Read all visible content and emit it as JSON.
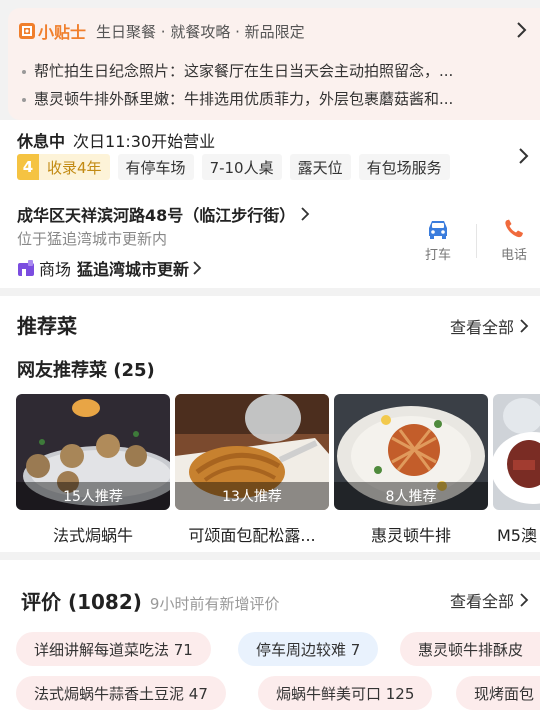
{
  "tips": {
    "logo_text": "小贴士",
    "tags": "生日聚餐 · 就餐攻略 · 新品限定",
    "items": [
      "帮忙拍生日纪念照片：这家餐厅在生日当天会主动拍照留念，...",
      "惠灵顿牛排外酥里嫩：牛排选用优质菲力，外层包裹蘑菇酱和..."
    ]
  },
  "info": {
    "status": "休息中",
    "open_time": "次日11:30开始营业",
    "years_badge_num": "4",
    "years_badge_text": "收录4年",
    "chips": [
      "有停车场",
      "7-10人桌",
      "露天位",
      "有包场服务"
    ],
    "address": "成华区天祥滨河路48号（临江步行街）",
    "address_sub": "位于猛追湾城市更新内",
    "mall_label": "商场",
    "mall_name": "猛追湾城市更新",
    "actions": [
      {
        "label": "打车",
        "icon": "car-icon",
        "color": "#3b7ddd"
      },
      {
        "label": "电话",
        "icon": "phone-icon",
        "color": "#f06a3c"
      }
    ]
  },
  "dishes": {
    "title": "推荐菜",
    "see_all": "查看全部",
    "subtitle": "网友推荐菜 (25)",
    "items": [
      {
        "name": "法式焗蜗牛",
        "rec": "15人推荐"
      },
      {
        "name": "可颂面包配松露...",
        "rec": "13人推荐"
      },
      {
        "name": "惠灵顿牛排",
        "rec": "8人推荐"
      },
      {
        "name": "M5澳",
        "rec": ""
      }
    ]
  },
  "reviews": {
    "title": "评价 (1082)",
    "subtitle": "9小时前有新增评价",
    "see_all": "查看全部",
    "tags_row1": [
      {
        "text": "详细讲解每道菜吃法 71",
        "style": "pink"
      },
      {
        "text": "停车周边较难 7",
        "style": "blue"
      },
      {
        "text": "惠灵顿牛排酥皮",
        "style": "pink"
      }
    ],
    "tags_row2": [
      {
        "text": "法式焗蜗牛蒜香土豆泥 47",
        "style": "pink"
      },
      {
        "text": "焗蜗牛鲜美可口 125",
        "style": "pink"
      },
      {
        "text": "现烤面包",
        "style": "pink"
      }
    ]
  },
  "colors": {
    "accent_orange": "#f07f2c",
    "badge_yellow": "#f5c342",
    "tip_bg": "#fbf1ee"
  }
}
